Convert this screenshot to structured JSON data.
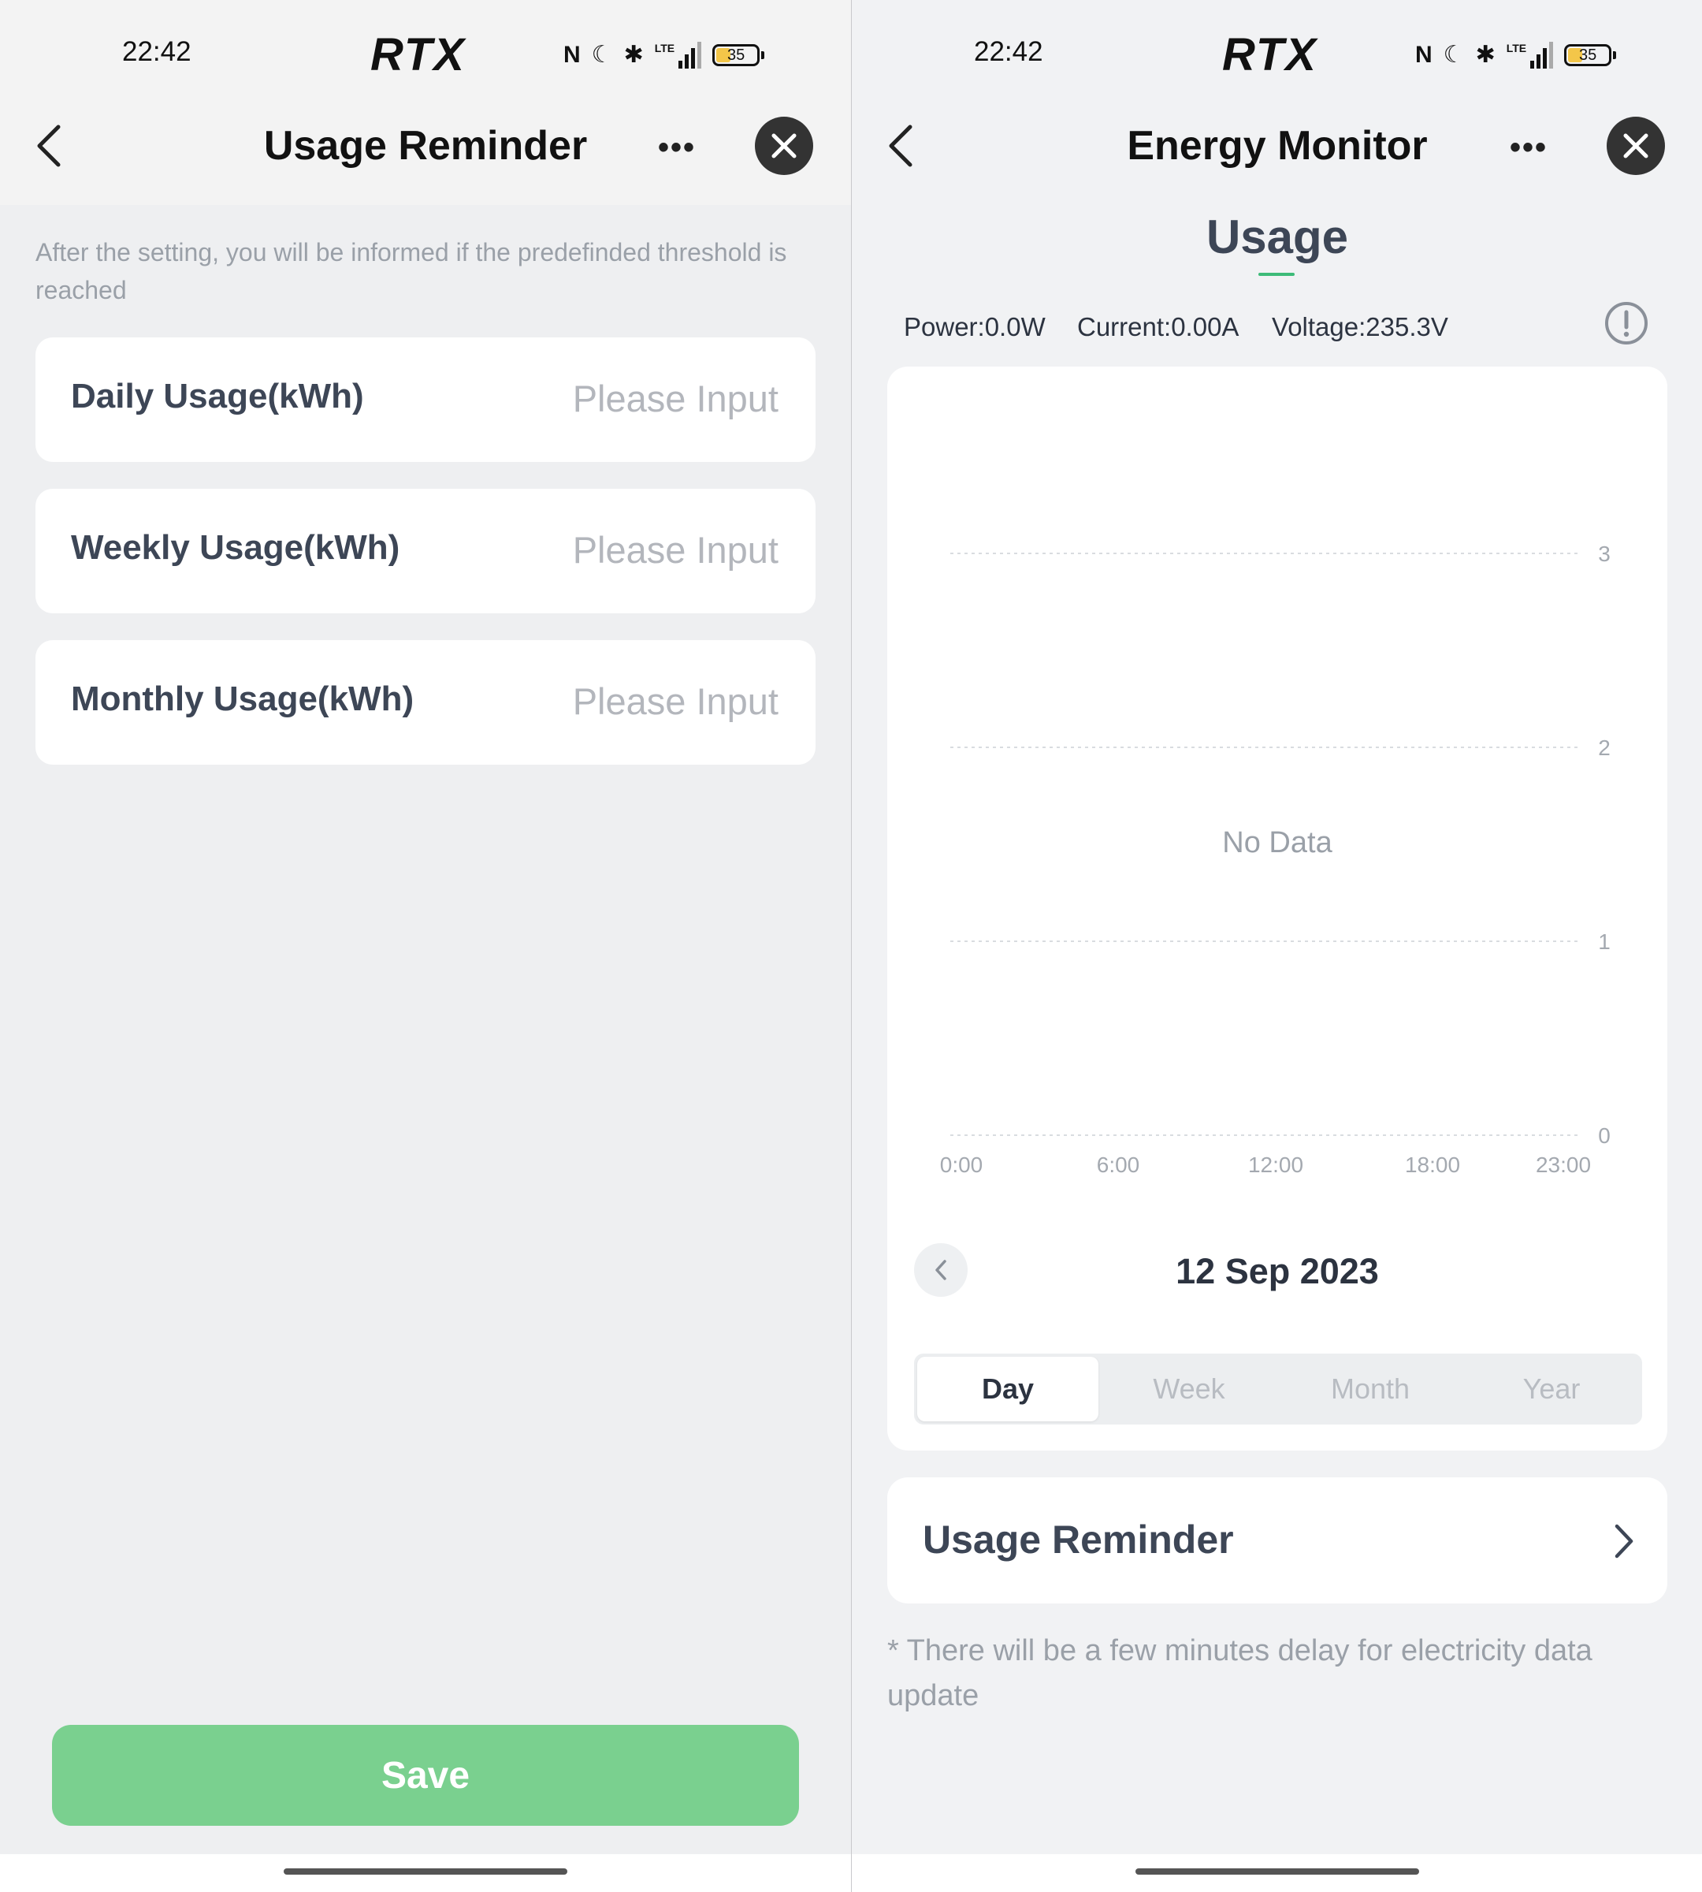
{
  "status_bar": {
    "time": "22:42",
    "brand": "RTX",
    "nfc": "N",
    "moon": "☾",
    "bluetooth": "✱",
    "network": "LTE",
    "battery": "35"
  },
  "left_screen": {
    "title": "Usage Reminder",
    "more": "•••",
    "hint": "After the setting, you will be informed if the predefinded threshold is reached",
    "fields": [
      {
        "label": "Daily Usage(kWh)",
        "placeholder": "Please Input",
        "value": ""
      },
      {
        "label": "Weekly Usage(kWh)",
        "placeholder": "Please Input",
        "value": ""
      },
      {
        "label": "Monthly Usage(kWh)",
        "placeholder": "Please Input",
        "value": ""
      }
    ],
    "save_label": "Save"
  },
  "right_screen": {
    "title": "Energy Monitor",
    "more": "•••",
    "section_title": "Usage",
    "metrics": {
      "power": "Power:0.0W",
      "current": "Current:0.00A",
      "voltage": "Voltage:235.3V"
    },
    "no_data": "No Data",
    "date": "12 Sep 2023",
    "periods": [
      "Day",
      "Week",
      "Month",
      "Year"
    ],
    "selected_period": "Day",
    "reminder_label": "Usage Reminder",
    "footnote": "* There will be a few minutes delay for electricity data update"
  },
  "chart_data": {
    "type": "line",
    "title": "",
    "xlabel": "",
    "ylabel": "",
    "x_ticks": [
      "0:00",
      "6:00",
      "12:00",
      "18:00",
      "23:00"
    ],
    "y_ticks": [
      "0",
      "1",
      "2",
      "3"
    ],
    "ylim": [
      0,
      3
    ],
    "y_axis_side": "right",
    "grid": true,
    "series": []
  },
  "colors": {
    "accent_green": "#3dbb78",
    "save_button": "#7ad08f",
    "dark_text": "#3d4656",
    "muted_text": "#9aa0a8"
  },
  "icons": [
    "back-icon",
    "more-icon",
    "close-icon",
    "info-icon",
    "chevron-left-icon",
    "chevron-right-icon",
    "nfc-icon",
    "moon-icon",
    "bluetooth-icon",
    "signal-icon",
    "battery-icon"
  ]
}
